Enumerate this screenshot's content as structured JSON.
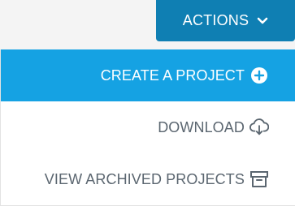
{
  "actions_button": {
    "label": "ACTIONS",
    "icon": "chevron-down-icon",
    "color": "#0f7fb3"
  },
  "menu": {
    "items": [
      {
        "label": "CREATE A PROJECT",
        "icon": "plus-circle-icon",
        "highlighted": true,
        "color": "#15a2e3"
      },
      {
        "label": "DOWNLOAD",
        "icon": "cloud-download-icon",
        "highlighted": false
      },
      {
        "label": "VIEW ARCHIVED PROJECTS",
        "icon": "archive-box-icon",
        "highlighted": false
      }
    ],
    "text_color": "#5b6670"
  }
}
